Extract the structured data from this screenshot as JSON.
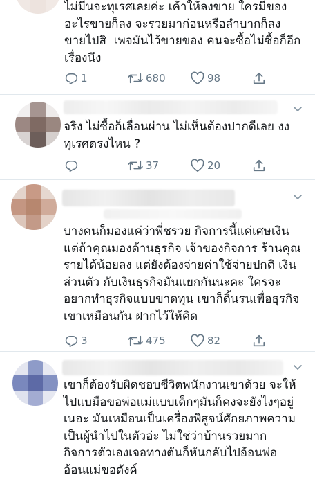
{
  "tweets": [
    {
      "text": "ไม่มีนจะทุเรศเลยค่ะ เค้าให้ลงขาย ใครมีของ\nอะไรขายก็ลง จะรวยมาก่อนหรือลำบากก็ลง\nขายไปสิ  เพจมันไว้ขายของ คนจะซื้อไม่ซื้อก็อีก\nเรื่องนึง",
      "replies": "1",
      "retweets": "680",
      "likes": "98"
    },
    {
      "text": "จริง ไม่ซื้อก็เลื่อนผ่าน ไม่เห็นต้องปากดีเลย งง\nทุเรศตรงไหน ?",
      "replies": "",
      "retweets": "37",
      "likes": "20"
    },
    {
      "text": "บางคนก็มองแค่ว่าพี่ชรวย กิจการนี้แค่เศษเงิน\nแต่ถ้าคุณมองด้านธุรกิจ เจ้าของกิจการ ร้านคุณ\nรายได้น้อยลง แต่ยังต้องจ่ายค่าใช้จ่ายปกติ เงิน\nส่วนตัว กับเงินธุรกิจมันแยกกันนะคะ ใครจะ\nอยากทำธุรกิจแบบขาดทุน เขาก็ดิ้นรนเพื่อธุรกิจ\nเขาเหมือนกัน ฝากไว้ให้คิด",
      "replies": "3",
      "retweets": "475",
      "likes": "82"
    },
    {
      "text": "เขาก็ต้องรับผิดชอบชีวิตพนักงานเขาด้วย จะให้\nไปแบมือขอพ่อแม่แบบเด็กๆมันก็คงจะยังไงๆอยู่\nเนอะ มันเหมือนเป็นเครื่องพิสูจน์ศักยภาพความ\nเป็นผู้นำไปในตัวอ่ะ ไม่ใช่ว่าบ้านรวยมาก\nกิจการตัวเองเจอทางตันก็หันกลับไปอ้อนพ่อ\nอ้อนแม่ขอตังค์"
    }
  ],
  "icons": {
    "reply": "reply-icon",
    "retweet": "retweet-icon",
    "like": "heart-icon",
    "share": "share-icon",
    "menu": "chevron-down-icon"
  },
  "colors": {
    "text": "#14171a",
    "secondary": "#657786",
    "divider": "#e1e8ed",
    "background": "#ffffff"
  }
}
